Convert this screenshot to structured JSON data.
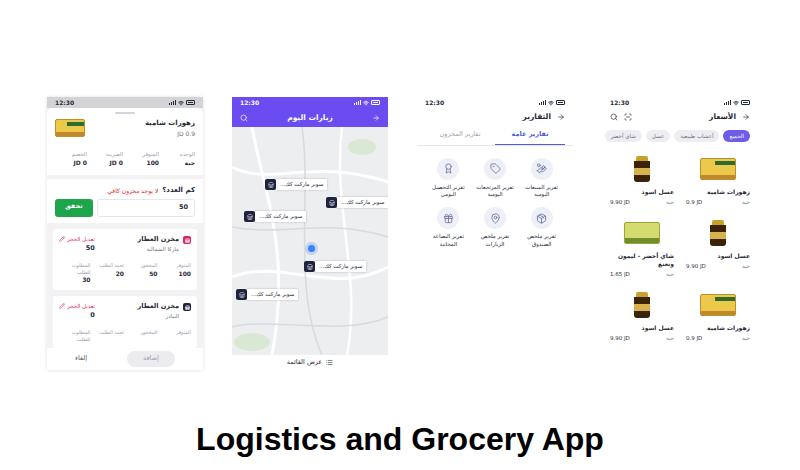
{
  "title": "Logistics and Grocery App",
  "product_stock": {
    "status_time": "12:30",
    "product": {
      "name": "زهورات شامية",
      "price": "0.9 JD",
      "kind": "box"
    },
    "stats": [
      {
        "label": "الوحدة",
        "value": "حبة"
      },
      {
        "label": "المتوفر",
        "value": "100"
      },
      {
        "label": "الضريبة",
        "value": "0 JD"
      },
      {
        "label": "الخصم",
        "value": "0 JD"
      }
    ],
    "quantity": {
      "question": "كم العدد؟",
      "warning": "لا يوجد مخزون كافي",
      "value": "50",
      "button": "تحقق"
    },
    "warehouses": [
      {
        "name": "مخزن العطار",
        "area": "ماركا الشمالية",
        "action": "تعديل الحجز",
        "reserved": "50",
        "color": "#e0245e",
        "stats": [
          {
            "label": "المتوفر",
            "value": "100"
          },
          {
            "label": "المحجوز",
            "value": "50"
          },
          {
            "label": "تحت الطلب",
            "value": "20"
          },
          {
            "label": "المطلوب للطلب",
            "value": "30"
          }
        ]
      },
      {
        "name": "مخزن العطار",
        "area": "البيادر",
        "action": "تعديل الحجز",
        "reserved": "0",
        "color": "#1f2340",
        "stats": [
          {
            "label": "المتوفر"
          },
          {
            "label": "المحجوز"
          },
          {
            "label": "تحت الطلب"
          },
          {
            "label": "المطلوب للطلب"
          }
        ]
      }
    ],
    "footer": {
      "cancel": "إلغاء",
      "add": {
        "label": "إضافة",
        "disabled": true
      }
    }
  },
  "visits_map": {
    "status_time": "12:30",
    "title": "زيارات اليوم",
    "pins": [
      {
        "label": "سوبر ماركت كك..."
      },
      {
        "label": "سوبر ماركت كك..."
      },
      {
        "label": "سوبر ماركت كك..."
      },
      {
        "label": "سوبر ماركت كك..."
      },
      {
        "label": "سوبر ماركت كك..."
      }
    ],
    "list_button": "عرض القائمة"
  },
  "reports": {
    "status_time": "12:30",
    "title": "التقارير",
    "tabs": [
      {
        "label": "تقارير عامة",
        "selected": true
      },
      {
        "label": "تقارير المخزون",
        "selected": false
      }
    ],
    "items": [
      {
        "label": "تقرير المبيعات اليومية",
        "kind": "sales"
      },
      {
        "label": "تقرير المرتجعات اليومية",
        "kind": "returns"
      },
      {
        "label": "تقرير التحصيل اليومي",
        "kind": "collection"
      },
      {
        "label": "تقرير ملخص الصندوق",
        "kind": "cash"
      },
      {
        "label": "تقرير ملخص الزيارات",
        "kind": "visits"
      },
      {
        "label": "تقرير البضاعة المجانية",
        "kind": "free"
      }
    ]
  },
  "prices": {
    "status_time": "12:30",
    "title": "الأسعار",
    "chips": [
      {
        "label": "الجميع",
        "selected": true
      },
      {
        "label": "أعشاب طبيعية",
        "selected": false
      },
      {
        "label": "عسل",
        "selected": false
      },
      {
        "label": "شاي أخضر",
        "selected": false
      }
    ],
    "products": [
      {
        "name": "زهورات شامية",
        "price": "0.9 JD",
        "unit": "حبة",
        "kind": "box"
      },
      {
        "name": "عسل اسود",
        "price": "9.90 JD",
        "unit": "حبة",
        "kind": "jar"
      },
      {
        "name": "عسل اسود",
        "price": "9.90 JD",
        "unit": "حبة",
        "kind": "jar"
      },
      {
        "name": "شاي أخضر - ليمون ونعنع",
        "price": "1.65 JD",
        "unit": "حبة",
        "kind": "tea"
      },
      {
        "name": "زهورات شامية",
        "price": "0.9 JD",
        "unit": "حبة",
        "kind": "box"
      },
      {
        "name": "عسل اسود",
        "price": "9.90 JD",
        "unit": "حبة",
        "kind": "jar"
      }
    ]
  }
}
